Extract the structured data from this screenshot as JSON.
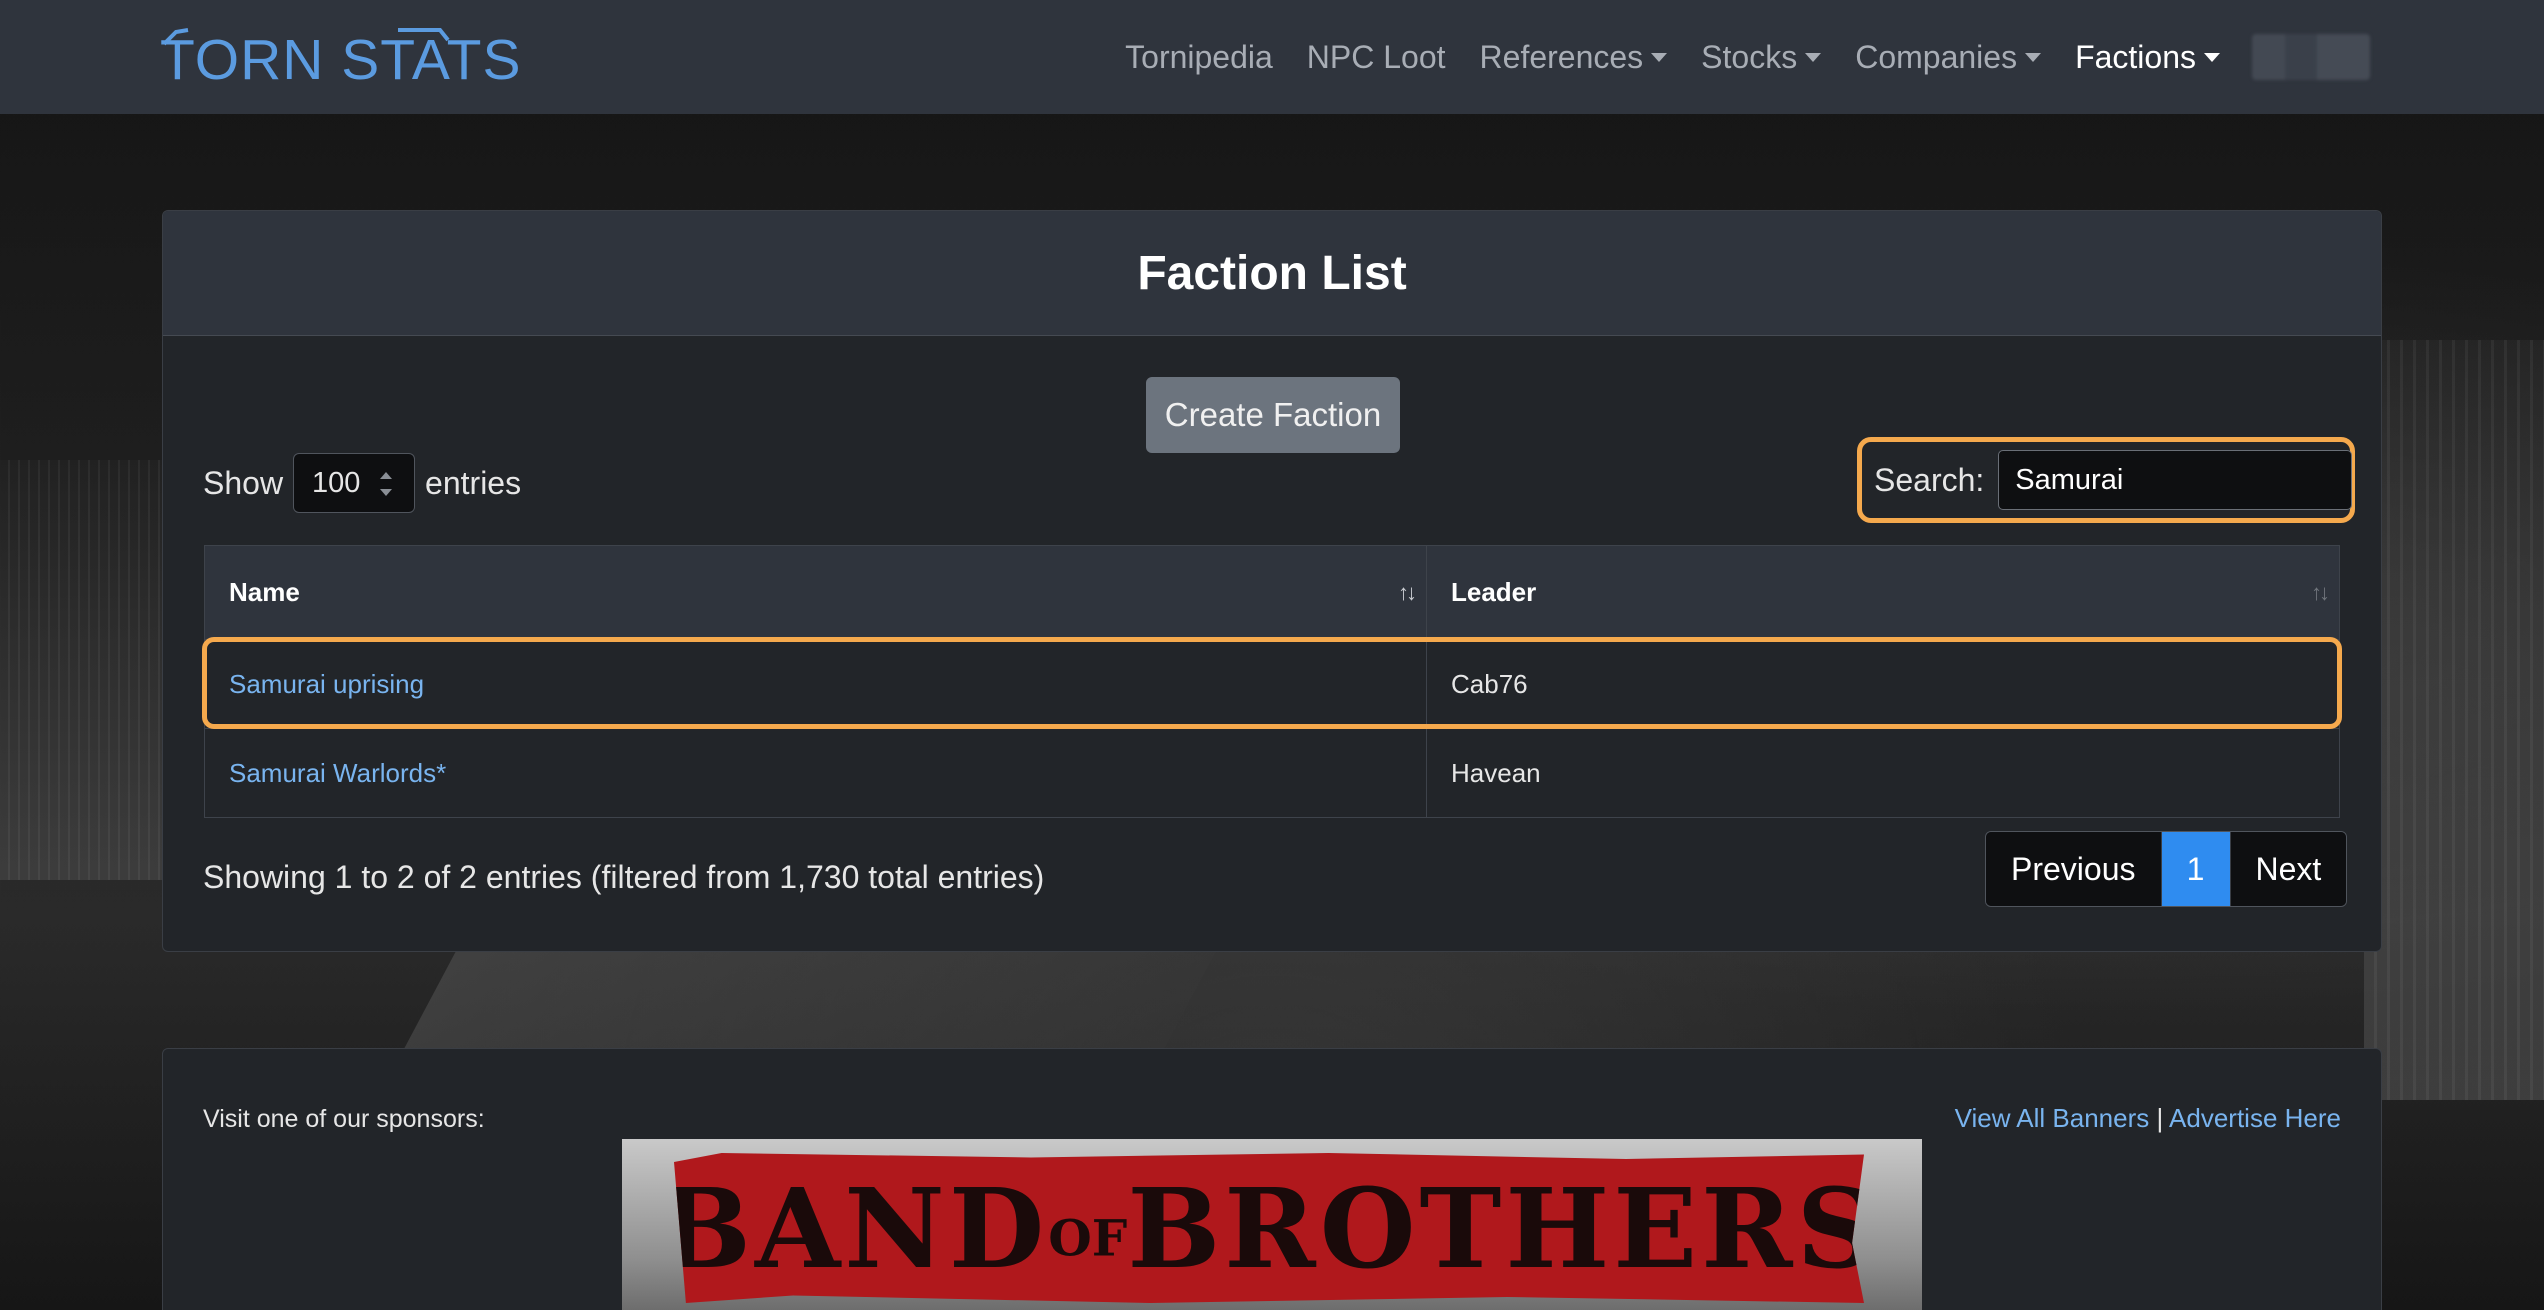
{
  "navbar": {
    "logo": "TORN STATS",
    "links": [
      {
        "label": "Tornipedia",
        "dropdown": false,
        "active": false
      },
      {
        "label": "NPC Loot",
        "dropdown": false,
        "active": false
      },
      {
        "label": "References",
        "dropdown": true,
        "active": false
      },
      {
        "label": "Stocks",
        "dropdown": true,
        "active": false
      },
      {
        "label": "Companies",
        "dropdown": true,
        "active": false
      },
      {
        "label": "Factions",
        "dropdown": true,
        "active": true
      }
    ]
  },
  "card": {
    "title": "Faction List",
    "create_button": "Create Faction",
    "show_label": "Show",
    "entries_value": "100",
    "entries_label": "entries",
    "search_label": "Search:",
    "search_value": "Samurai"
  },
  "table": {
    "columns": [
      "Name",
      "Leader"
    ],
    "rows": [
      {
        "name": "Samurai uprising",
        "leader": "Cab76"
      },
      {
        "name": "Samurai Warlords*",
        "leader": "Havean"
      }
    ]
  },
  "footer": {
    "info": "Showing 1 to 2 of 2 entries (filtered from 1,730 total entries)",
    "prev": "Previous",
    "current_page": "1",
    "next": "Next"
  },
  "sponsor": {
    "label": "Visit one of our sponsors:",
    "view_all": "View All Banners",
    "separator": "|",
    "advertise": "Advertise Here",
    "banner_text_1": "BAND",
    "banner_text_of": "OF",
    "banner_text_2": "BROTHERS"
  },
  "colors": {
    "accent": "#5b9be0",
    "highlight": "#f5a94d",
    "link": "#79b4ef",
    "page_active": "#2f8cf0",
    "banner_red": "#b0181c"
  }
}
